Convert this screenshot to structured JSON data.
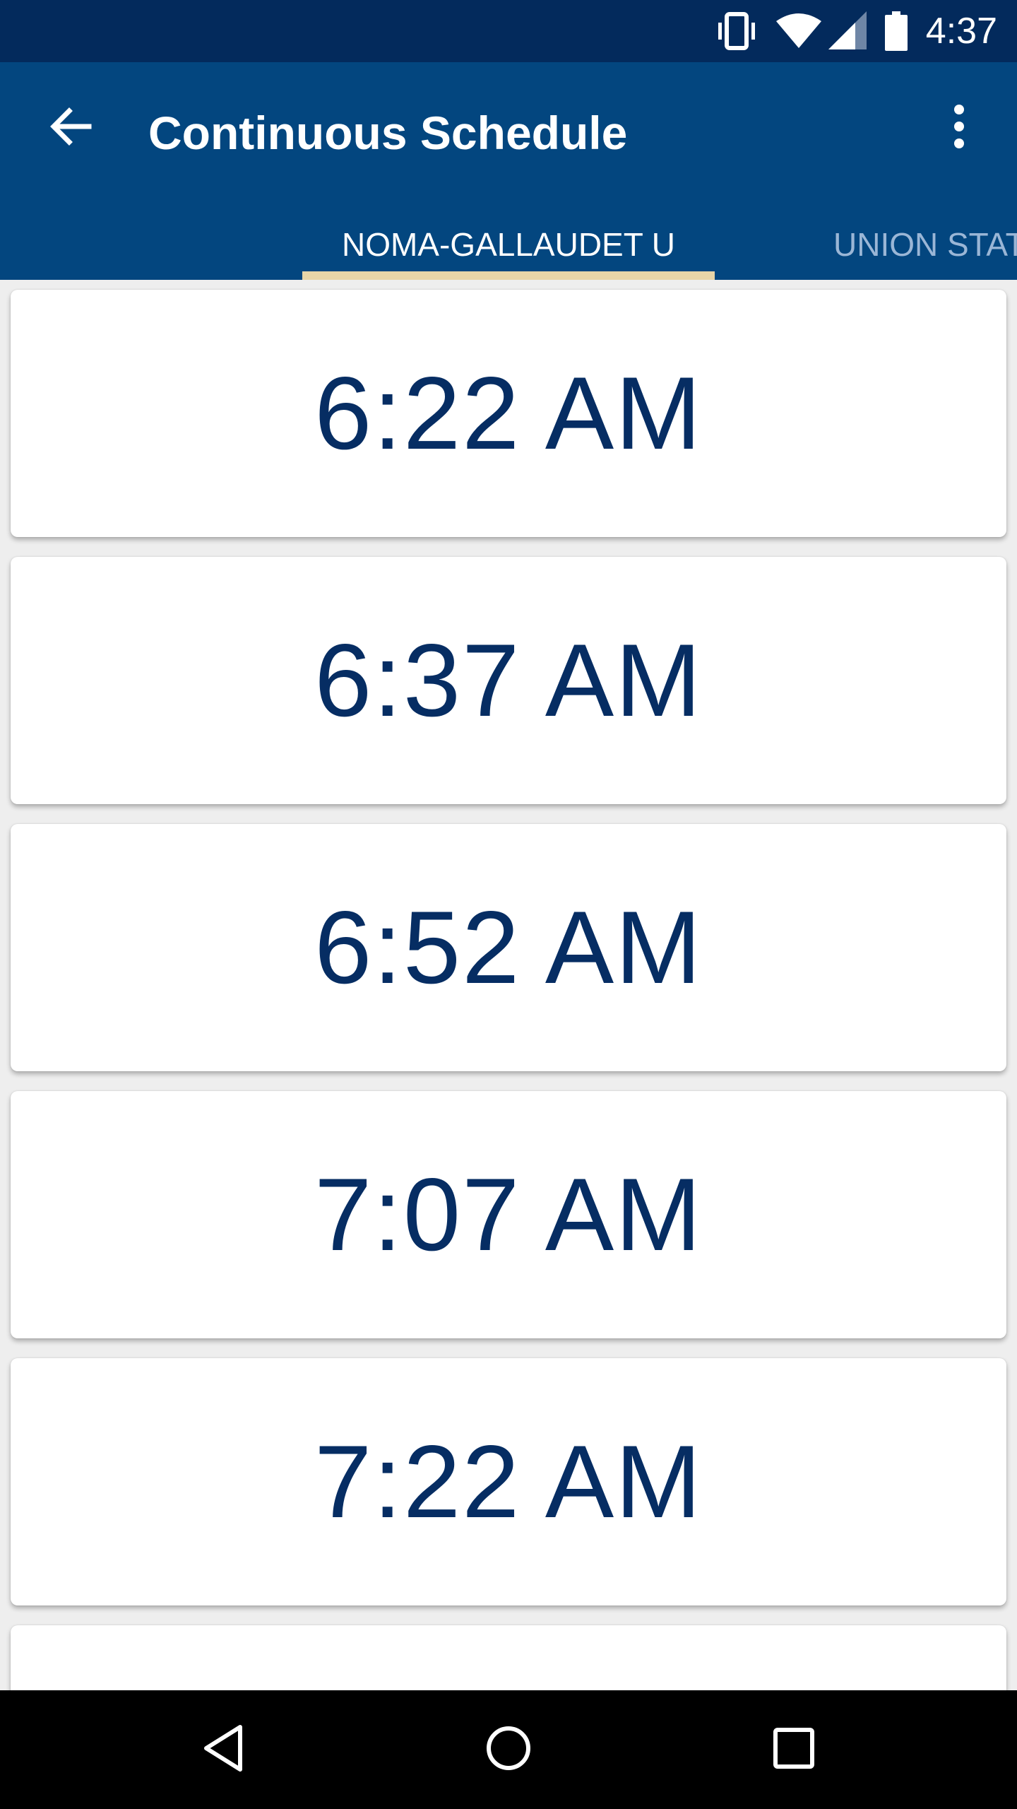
{
  "status_bar": {
    "time": "4:37",
    "icons": [
      "vibrate-icon",
      "wifi-icon",
      "cell-signal-icon",
      "battery-icon"
    ]
  },
  "app_bar": {
    "title": "Continuous Schedule",
    "back_icon": "arrow-back-icon",
    "menu_icon": "more-vert-icon"
  },
  "tabs": [
    {
      "label": "NOMA-GALLAUDET U",
      "selected": true
    },
    {
      "label": "UNION STATION",
      "selected": false
    }
  ],
  "schedule": [
    {
      "time": "6:22 AM"
    },
    {
      "time": "6:37 AM"
    },
    {
      "time": "6:52 AM"
    },
    {
      "time": "7:07 AM"
    },
    {
      "time": "7:22 AM"
    },
    {
      "time": ""
    }
  ],
  "nav_bar": {
    "icons": [
      "nav-back-icon",
      "nav-home-icon",
      "nav-recents-icon"
    ]
  },
  "colors": {
    "status_bar": "#032a5c",
    "app_bar": "#03467f",
    "tab_indicator": "#e8d5a8",
    "time_text": "#062d63",
    "background": "#eeeeee"
  }
}
